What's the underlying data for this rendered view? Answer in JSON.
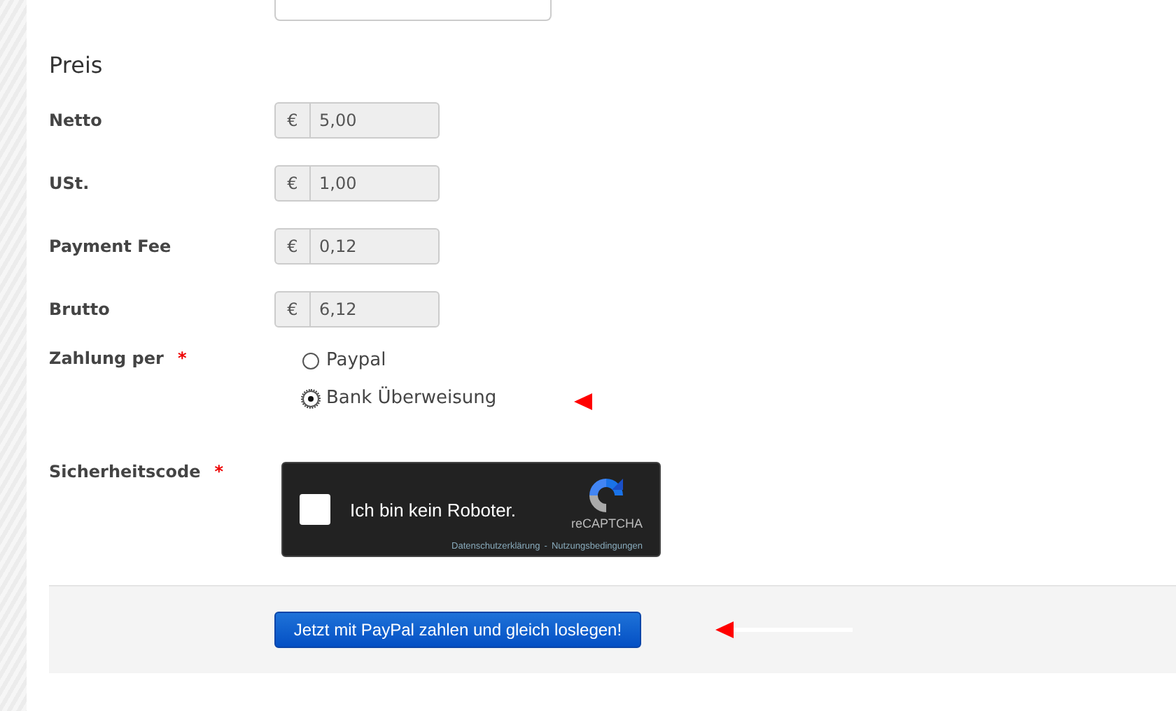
{
  "section_title": "Preis",
  "price_fields": [
    {
      "label": "Netto",
      "currency": "€",
      "value": "5,00"
    },
    {
      "label": "USt.",
      "currency": "€",
      "value": "1,00"
    },
    {
      "label": "Payment Fee",
      "currency": "€",
      "value": "0,12"
    },
    {
      "label": "Brutto",
      "currency": "€",
      "value": "6,12"
    }
  ],
  "payment": {
    "label": "Zahlung per",
    "required_mark": "*",
    "options": [
      {
        "label": "Paypal",
        "selected": false,
        "annotated": false
      },
      {
        "label": "Bank Überweisung",
        "selected": true,
        "annotated": true
      }
    ]
  },
  "captcha": {
    "label": "Sicherheitscode",
    "required_mark": "*",
    "checked": false,
    "text": "Ich bin kein Roboter.",
    "brand": "reCAPTCHA",
    "links": [
      "Datenschutzerklärung",
      "Nutzungsbedingungen"
    ],
    "separator": "-"
  },
  "submit": {
    "label": "Jetzt mit PayPal zahlen und gleich loslegen!",
    "annotated": true
  }
}
